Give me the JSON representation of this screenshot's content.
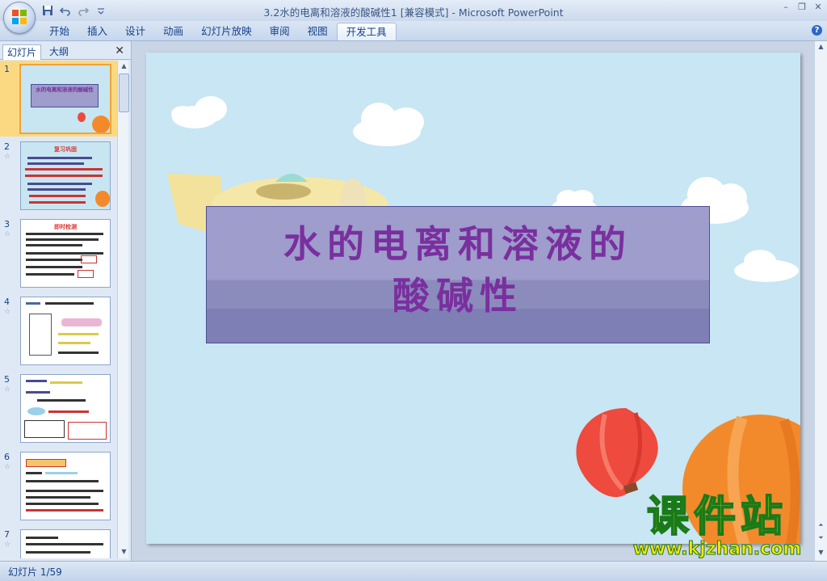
{
  "window": {
    "title": "3.2水的电离和溶液的酸碱性1 [兼容模式]",
    "app_name": "Microsoft PowerPoint",
    "separator": " - "
  },
  "quick_access": [
    {
      "icon": "save-icon"
    },
    {
      "icon": "undo-icon"
    },
    {
      "icon": "redo-icon"
    },
    {
      "icon": "customize-icon"
    }
  ],
  "ribbon": {
    "tabs": [
      {
        "label": "开始",
        "active": false
      },
      {
        "label": "插入",
        "active": false
      },
      {
        "label": "设计",
        "active": false
      },
      {
        "label": "动画",
        "active": false
      },
      {
        "label": "幻灯片放映",
        "active": false
      },
      {
        "label": "审阅",
        "active": false
      },
      {
        "label": "视图",
        "active": false
      },
      {
        "label": "开发工具",
        "active": true
      }
    ]
  },
  "left_pane": {
    "tab_slides": "幻灯片",
    "tab_outline": "大纲",
    "thumbnails": [
      {
        "num": "1",
        "title": "水的电离和溶液的酸碱性",
        "selected": true
      },
      {
        "num": "2",
        "title": "复习巩固",
        "selected": false
      },
      {
        "num": "3",
        "title": "即时检测",
        "selected": false
      },
      {
        "num": "4",
        "title": "",
        "selected": false
      },
      {
        "num": "5",
        "title": "",
        "selected": false
      },
      {
        "num": "6",
        "title": "",
        "selected": false
      },
      {
        "num": "7",
        "title": "",
        "selected": false
      }
    ]
  },
  "slide": {
    "title_line1": "水的电离和溶液的",
    "title_line2": "酸碱性"
  },
  "watermark": {
    "title": "课件站",
    "url": "www.kjzhan.com"
  },
  "status": {
    "slide_counter": "幻灯片 1/59"
  },
  "colors": {
    "slide_bg": "#c8e6f3",
    "title_text": "#7a2f9f",
    "title_box": "#9e9dcb",
    "balloon_red": "#ee4a3e",
    "balloon_orange": "#f28a2c",
    "selected_thumb": "#fbd983"
  }
}
